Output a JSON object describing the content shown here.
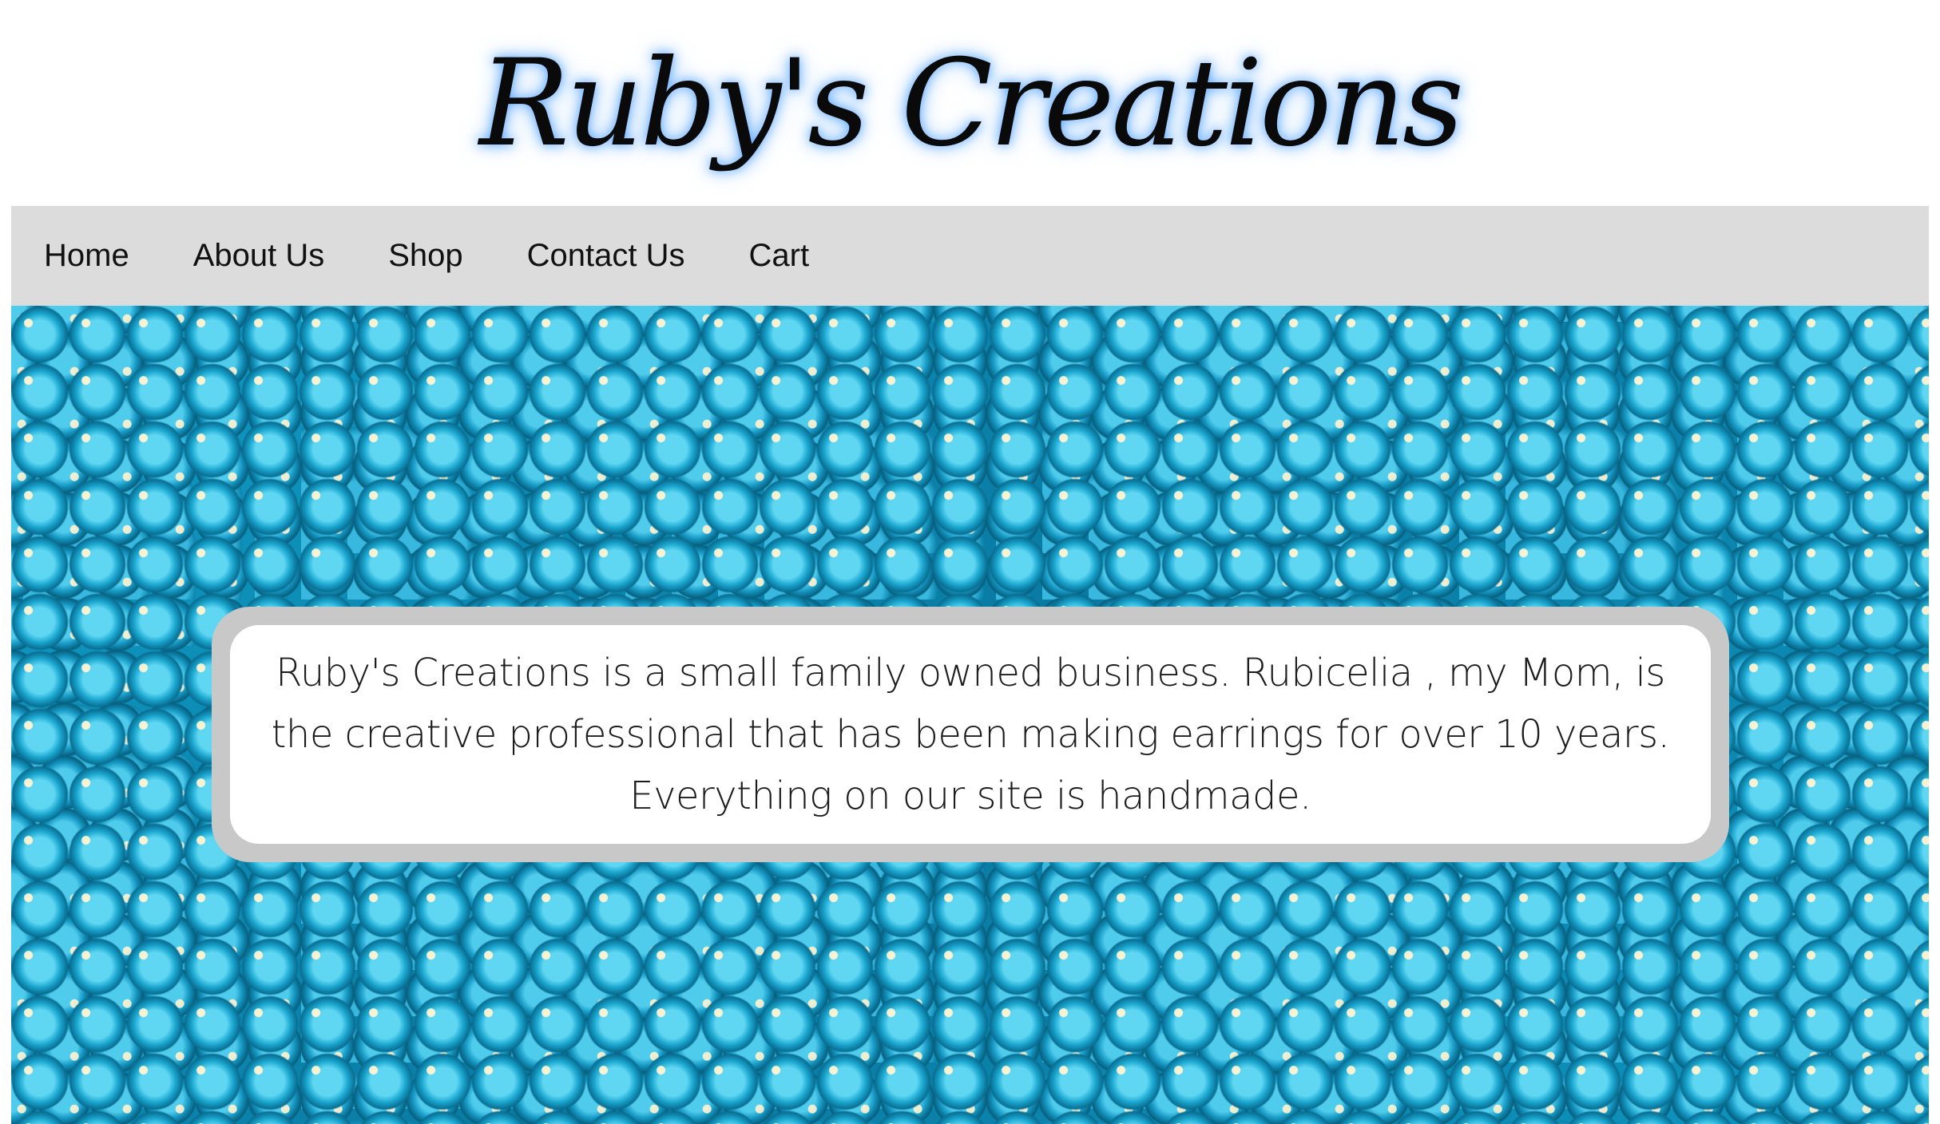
{
  "header": {
    "title": "Ruby's Creations",
    "title_glow_color": "#3c96ff"
  },
  "nav": {
    "background_color": "#dcdcdc",
    "items": [
      {
        "label": "Home"
      },
      {
        "label": "About Us"
      },
      {
        "label": "Shop"
      },
      {
        "label": "Contact Us"
      },
      {
        "label": "Cart"
      }
    ]
  },
  "hero": {
    "background": "blue glass seed beads",
    "accent_color": "#0c8fb8",
    "info_text": "Ruby's Creations is a small family owned business. Rubicelia , my Mom, is the creative professional that has been making earrings for over 10 years. Everything on our site is handmade."
  }
}
